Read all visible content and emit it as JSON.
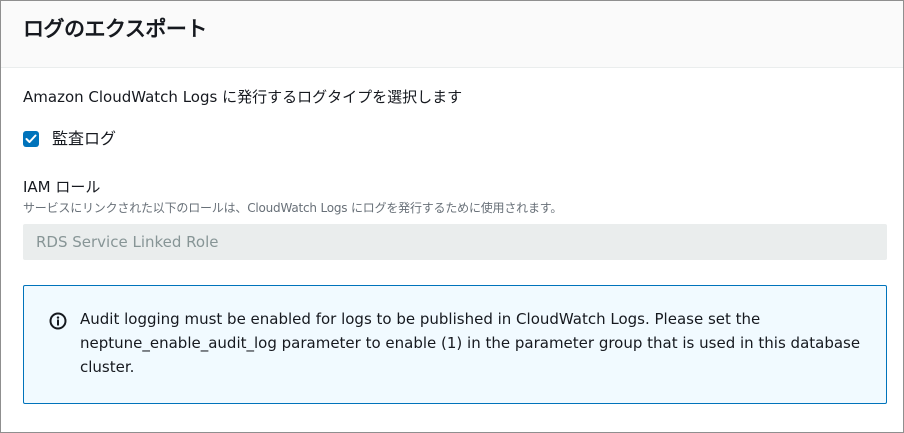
{
  "panel": {
    "title": "ログのエクスポート",
    "description": "Amazon CloudWatch Logs に発行するログタイプを選択します"
  },
  "checkbox": {
    "label": "監査ログ",
    "checked": true,
    "color": "#0073bb"
  },
  "iam_role": {
    "label": "IAM ロール",
    "hint": "サービスにリンクされた以下のロールは、CloudWatch Logs にログを発行するために使用されます。",
    "value": "RDS Service Linked Role"
  },
  "alert": {
    "icon": "info-icon",
    "text": "Audit logging must be enabled for logs to be published in CloudWatch Logs. Please set the neptune_enable_audit_log parameter to enable (1) in the parameter group that is used in this database cluster.",
    "border_color": "#0073bb",
    "background_color": "#f1faff"
  }
}
